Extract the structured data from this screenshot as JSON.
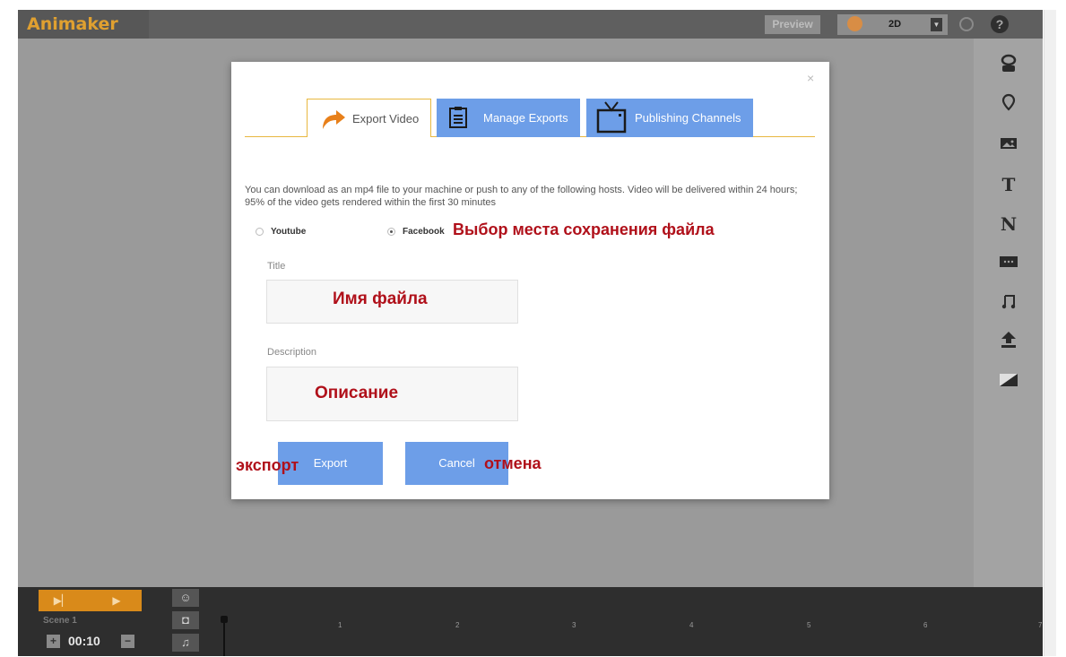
{
  "app": {
    "logo": "Animaker",
    "preview_label": "Preview",
    "mode_value": "2D",
    "mode_arrow": "▼",
    "help_label": "?"
  },
  "toolbar_right": {
    "icons": [
      "character-icon",
      "prop-icon",
      "image-icon",
      "text-icon",
      "number-icon",
      "video-icon",
      "music-icon",
      "upload-icon",
      "background-icon"
    ]
  },
  "modal": {
    "close": "×",
    "tabs": [
      {
        "label": "Export Video",
        "active": true
      },
      {
        "label": "Manage Exports",
        "active": false
      },
      {
        "label": "Publishing Channels",
        "active": false
      }
    ],
    "info_line1": "You can download as an mp4 file to your machine or push to any of the following hosts. Video will be delivered within 24 hours;",
    "info_line2": "95% of the video gets rendered within the first 30 minutes",
    "options": [
      {
        "label": "Youtube",
        "selected": false
      },
      {
        "label": "Facebook",
        "selected": true
      }
    ],
    "title_label": "Title",
    "title_value": "",
    "description_label": "Description",
    "description_value": "",
    "export_label": "Export",
    "cancel_label": "Cancel"
  },
  "annotations": {
    "destination": "Выбор места сохранения файла",
    "filename": "Имя файла",
    "description": "Описание",
    "export": "экспорт",
    "cancel": "отмена"
  },
  "timeline": {
    "scene_label": "Scene 1",
    "duration": "00:10",
    "plus": "+",
    "minus": "−",
    "ticks": [
      "1",
      "2",
      "3",
      "4",
      "5",
      "6",
      "7"
    ]
  },
  "colors": {
    "accent_orange": "#d98a1a",
    "tab_blue": "#6d9ee8",
    "annotation_red": "#b0101a"
  }
}
